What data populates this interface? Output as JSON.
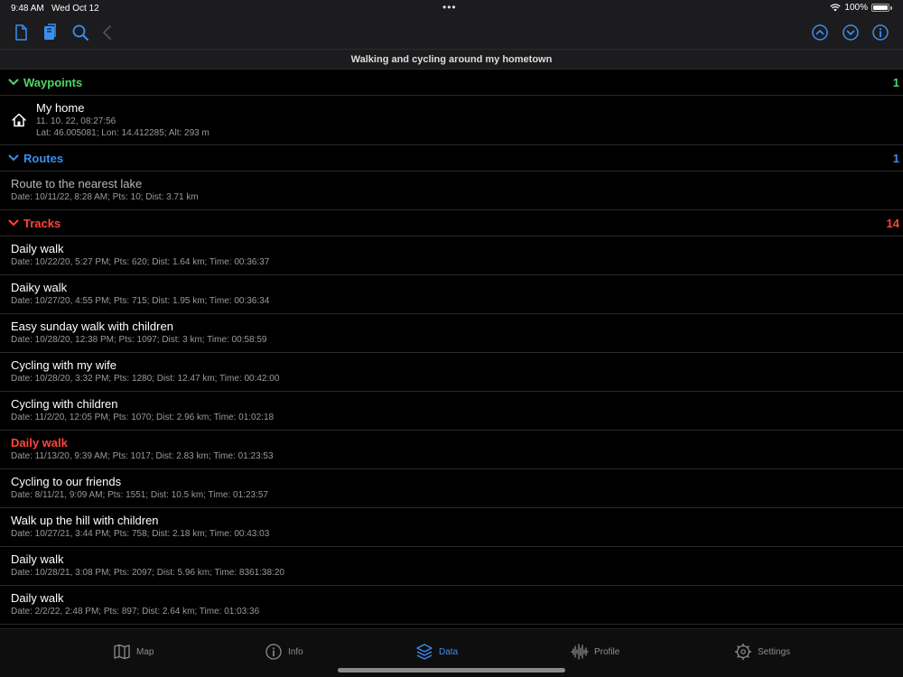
{
  "status": {
    "time": "9:48 AM",
    "date": "Wed Oct 12",
    "battery": "100%"
  },
  "document_title": "Walking and cycling around my hometown",
  "sections": {
    "waypoints": {
      "title": "Waypoints",
      "count": "1"
    },
    "routes": {
      "title": "Routes",
      "count": "1"
    },
    "tracks": {
      "title": "Tracks",
      "count": "14"
    }
  },
  "waypoints": [
    {
      "name": "My home",
      "datetime": "11. 10. 22, 08:27:56",
      "coords": "Lat: 46.005081; Lon: 14.412285; Alt: 293 m"
    }
  ],
  "routes": [
    {
      "name": "Route to the nearest lake",
      "details": "Date: 10/11/22, 8:28 AM; Pts: 10; Dist: 3.71 km"
    }
  ],
  "tracks": [
    {
      "name": "Daily walk",
      "details": "Date: 10/22/20, 5:27 PM; Pts: 620; Dist: 1.64 km; Time: 00:36:37"
    },
    {
      "name": "Daiky walk",
      "details": "Date: 10/27/20, 4:55 PM; Pts: 715; Dist: 1.95 km; Time: 00:36:34"
    },
    {
      "name": "Easy sunday walk with children",
      "details": "Date: 10/28/20, 12:38 PM; Pts: 1097; Dist: 3 km; Time: 00:58:59"
    },
    {
      "name": "Cycling with my wife",
      "details": "Date: 10/28/20, 3:32 PM; Pts: 1280; Dist: 12.47 km; Time: 00:42:00"
    },
    {
      "name": "Cycling with children",
      "details": "Date: 11/2/20, 12:05 PM; Pts: 1070; Dist: 2.96 km; Time: 01:02:18"
    },
    {
      "name": "Daily walk",
      "details": "Date: 11/13/20, 9:39 AM; Pts: 1017; Dist: 2.83 km; Time: 01:23:53"
    },
    {
      "name": "Cycling to our friends",
      "details": "Date: 8/11/21, 9:09 AM; Pts: 1551; Dist: 10.5 km; Time: 01:23:57"
    },
    {
      "name": "Walk up the hill with children",
      "details": "Date: 10/27/21, 3:44 PM; Pts: 758; Dist: 2.18 km; Time: 00:43:03"
    },
    {
      "name": "Daily walk",
      "details": "Date: 10/28/21, 3:08 PM; Pts: 2097; Dist: 5.96 km; Time: 8361:38:20"
    },
    {
      "name": "Daily walk",
      "details": "Date: 2/2/22, 2:48 PM; Pts: 897; Dist: 2.64 km; Time: 01:03:36"
    }
  ],
  "tabs": [
    {
      "label": "Map",
      "icon": "map-icon"
    },
    {
      "label": "Info",
      "icon": "info-icon"
    },
    {
      "label": "Data",
      "icon": "layers-icon"
    },
    {
      "label": "Profile",
      "icon": "waveform-icon"
    },
    {
      "label": "Settings",
      "icon": "gear-icon"
    }
  ],
  "colors": {
    "accent": "#3a8ef0",
    "waypoints": "#4cd964",
    "tracks": "#ff453a",
    "background": "#000000"
  }
}
